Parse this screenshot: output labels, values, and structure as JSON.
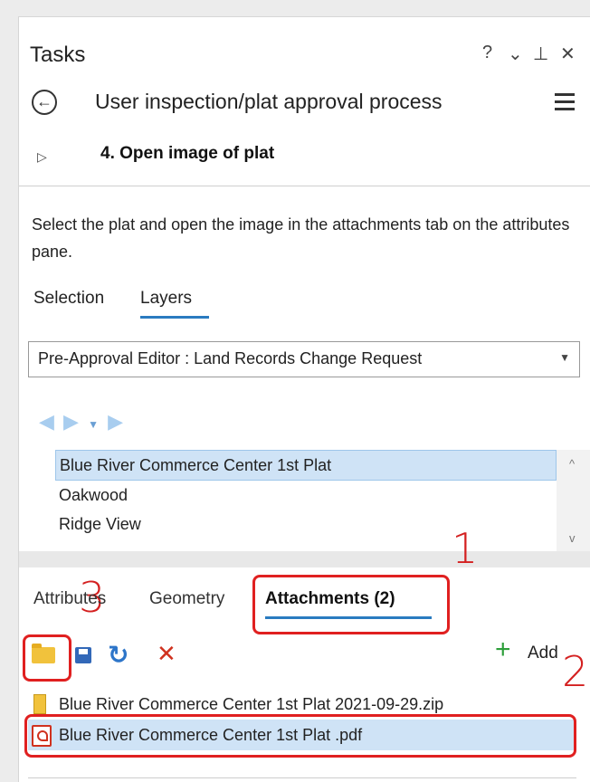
{
  "header": {
    "title": "Tasks",
    "help_glyph": "?",
    "menu_glyph": "⌄",
    "pin_glyph": "⊥",
    "close_glyph": "✕"
  },
  "task": {
    "title": "User inspection/plat approval process",
    "step": "4.  Open image of plat",
    "description": "Select the plat and open the image in the attachments tab on the attributes pane."
  },
  "tabs": {
    "selection": "Selection",
    "layers": "Layers"
  },
  "layer_dropdown": {
    "selected": "Pre-Approval Editor : Land Records Change Request"
  },
  "features": [
    "Blue River Commerce Center 1st Plat",
    "Oakwood",
    "Ridge View"
  ],
  "detail_tabs": {
    "attributes": "Attributes",
    "geometry": "Geometry",
    "attachments": "Attachments (2)"
  },
  "toolbar": {
    "add_label": "Add"
  },
  "attachments": [
    "Blue River Commerce Center 1st Plat 2021-09-29.zip",
    "Blue River Commerce Center 1st Plat .pdf"
  ],
  "annotations": [
    "1",
    "2",
    "3"
  ],
  "colors": {
    "accent_blue": "#2a7bc0",
    "selection_blue": "#cfe3f6",
    "annotation_red": "#e02020",
    "add_green": "#2d9f3b",
    "delete_red": "#d0321f"
  }
}
